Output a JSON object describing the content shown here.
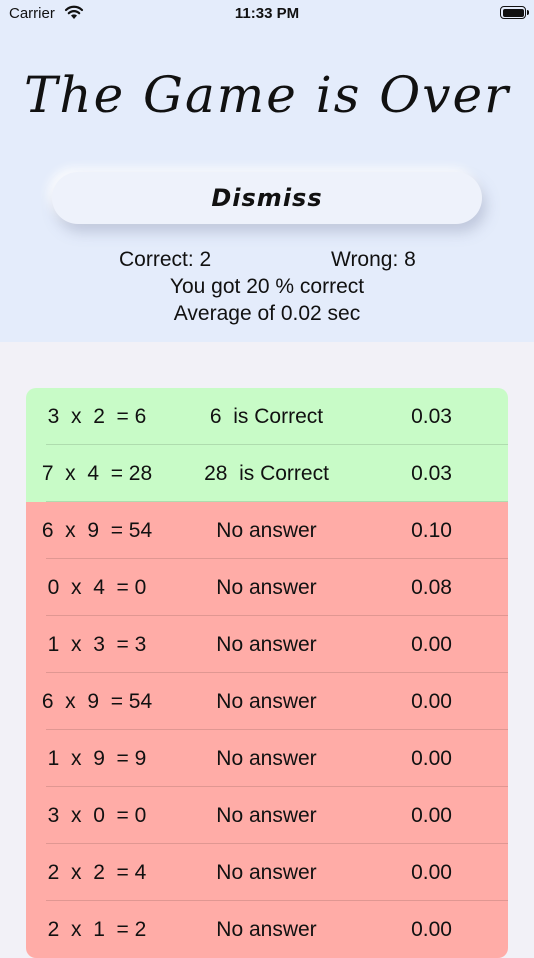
{
  "status_bar": {
    "carrier": "Carrier",
    "time": "11:33 PM"
  },
  "header": {
    "title": "The Game is Over",
    "dismiss_label": "Dismiss"
  },
  "summary": {
    "correct": "Correct: 2",
    "wrong": "Wrong: 8",
    "percent": "You got 20 % correct",
    "average": "Average of 0.02 sec"
  },
  "colors": {
    "header_bg": "#e4ecfb",
    "correct_row": "#c8fbc7",
    "wrong_row": "#ffaca7"
  },
  "results": [
    {
      "equation": "3  x  2  = 6",
      "answer": "6  is Correct",
      "time": "0.03",
      "status": "correct"
    },
    {
      "equation": "7  x  4  = 28",
      "answer": "28  is Correct",
      "time": "0.03",
      "status": "correct"
    },
    {
      "equation": "6  x  9  = 54",
      "answer": "No answer",
      "time": "0.10",
      "status": "wrong"
    },
    {
      "equation": "0  x  4  = 0",
      "answer": "No answer",
      "time": "0.08",
      "status": "wrong"
    },
    {
      "equation": "1  x  3  = 3",
      "answer": "No answer",
      "time": "0.00",
      "status": "wrong"
    },
    {
      "equation": "6  x  9  = 54",
      "answer": "No answer",
      "time": "0.00",
      "status": "wrong"
    },
    {
      "equation": "1  x  9  = 9",
      "answer": "No answer",
      "time": "0.00",
      "status": "wrong"
    },
    {
      "equation": "3  x  0  = 0",
      "answer": "No answer",
      "time": "0.00",
      "status": "wrong"
    },
    {
      "equation": "2  x  2  = 4",
      "answer": "No answer",
      "time": "0.00",
      "status": "wrong"
    },
    {
      "equation": "2  x  1  = 2",
      "answer": "No answer",
      "time": "0.00",
      "status": "wrong"
    }
  ]
}
